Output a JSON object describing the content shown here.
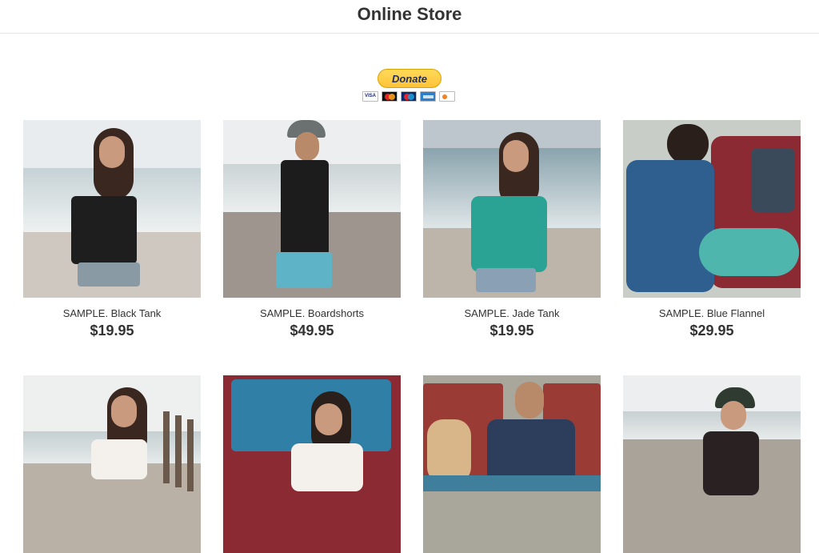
{
  "header": {
    "title": "Online Store"
  },
  "donate": {
    "label": "Donate",
    "cards": [
      "visa-icon",
      "mastercard-icon",
      "maestro-icon",
      "amex-icon",
      "discover-icon"
    ]
  },
  "products": [
    {
      "name": "SAMPLE. Black Tank",
      "price": "$19.95"
    },
    {
      "name": "SAMPLE. Boardshorts",
      "price": "$49.95"
    },
    {
      "name": "SAMPLE. Jade Tank",
      "price": "$19.95"
    },
    {
      "name": "SAMPLE. Blue Flannel",
      "price": "$29.95"
    },
    {
      "name": "",
      "price": ""
    },
    {
      "name": "",
      "price": ""
    },
    {
      "name": "",
      "price": ""
    },
    {
      "name": "",
      "price": ""
    }
  ],
  "colors": {
    "paypal_yellow": "#ffc439",
    "text": "#333333"
  }
}
